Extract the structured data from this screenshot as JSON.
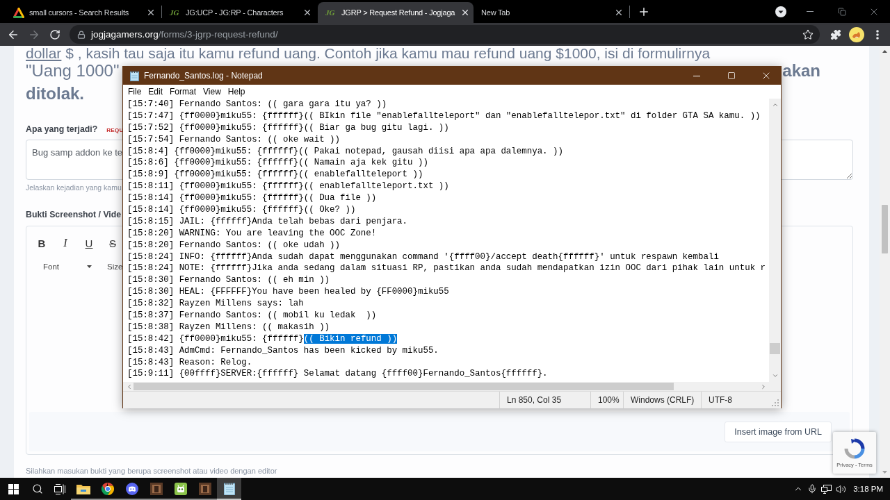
{
  "browser": {
    "tabs": [
      {
        "title": "small cursors - Search Results",
        "selected": false,
        "kind": "triangle"
      },
      {
        "title": "JG:UCP - JG:RP - Characters",
        "selected": false,
        "kind": "lettermark",
        "favicon_text": "JG"
      },
      {
        "title": "JGRP > Request Refund - Jogjaga",
        "selected": true,
        "kind": "lettermark",
        "favicon_text": "JG"
      },
      {
        "title": "New Tab",
        "selected": false,
        "kind": "plain"
      }
    ],
    "forward_disabled": true,
    "address": {
      "host": "jogjagamers.org",
      "path": "/forms/3-jgrp-request-refund/"
    }
  },
  "page": {
    "notice": {
      "link": "dollar",
      "line_1": " $ , kasih tau saja itu kamu refund uang. Contoh jika kamu mau refund uang $1000, isi di formulirnya",
      "line_2_start": "\"Uang 1000\"",
      "line_2_end": "akan",
      "line_3": "ditolak."
    },
    "question": {
      "label": "Apa yang terjadi?",
      "badge": "REQU",
      "value": "Bug samp addon ke te",
      "hint": "Jelaskan kejadian yang kamu"
    },
    "evidence": {
      "label": "Bukti Screenshot / Vide",
      "format_buttons": [
        {
          "kind": "bold",
          "label": "B"
        },
        {
          "kind": "italic",
          "label": "I"
        },
        {
          "kind": "underline",
          "label": "U"
        },
        {
          "kind": "strike",
          "label": "S"
        }
      ],
      "font_select": "Font",
      "size_select": "Size",
      "insert_button": "Insert image from URL",
      "hint": "Silahkan masukan bukti yang berupa screenshot atau video dengan editor"
    },
    "captcha": {
      "links": "Privacy - Terms"
    }
  },
  "notepad": {
    "title": "Fernando_Santos.log - Notepad",
    "menu": [
      "File",
      "Edit",
      "Format",
      "View",
      "Help"
    ],
    "lines": [
      {
        "text": "[15:7:40] Fernando Santos: (( gara gara itu ya? ))",
        "selected": false
      },
      {
        "text": "[15:7:47] {ff0000}miku55: {ffffff}(( BIkin file \"enablefallteleport\" dan \"enablefalltelepor.txt\" di folder GTA SA kamu. ))",
        "selected": false
      },
      {
        "text": "[15:7:52] {ff0000}miku55: {ffffff}(( Biar ga bug gitu lagi. ))",
        "selected": false
      },
      {
        "text": "[15:7:54] Fernando Santos: (( oke wait ))",
        "selected": false
      },
      {
        "text": "[15:8:4] {ff0000}miku55: {ffffff}(( Pakai notepad, gausah diisi apa apa dalemnya. ))",
        "selected": false
      },
      {
        "text": "[15:8:6] {ff0000}miku55: {ffffff}(( Namain aja kek gitu ))",
        "selected": false
      },
      {
        "text": "[15:8:9] {ff0000}miku55: {ffffff}(( enablefallteleport ))",
        "selected": false
      },
      {
        "text": "[15:8:11] {ff0000}miku55: {ffffff}(( enablefallteleport.txt ))",
        "selected": false
      },
      {
        "text": "[15:8:14] {ff0000}miku55: {ffffff}(( Dua file ))",
        "selected": false
      },
      {
        "text": "[15:8:14] {ff0000}miku55: {ffffff}(( Oke? ))",
        "selected": false
      },
      {
        "text": "[15:8:15] JAIL: {ffffff}Anda telah bebas dari penjara.",
        "selected": false
      },
      {
        "text": "[15:8:20] WARNING: You are leaving the OOC Zone!",
        "selected": false
      },
      {
        "text": "[15:8:20] Fernando Santos: (( oke udah ))",
        "selected": false
      },
      {
        "text": "[15:8:24] INFO: {ffffff}Anda sudah dapat menggunakan command '{ffff00}/accept death{ffffff}' untuk respawn kembali",
        "selected": false
      },
      {
        "text": "[15:8:24] NOTE: {ffffff}Jika anda sedang dalam situasi RP, pastikan anda sudah mendapatkan izin OOC dari pihak lain untuk r",
        "selected": false
      },
      {
        "text": "[15:8:30] Fernando Santos: (( eh min ))",
        "selected": false
      },
      {
        "text": "[15:8:30] HEAL: {FFFFFF}You have been healed by {FF0000}miku55",
        "selected": false
      },
      {
        "text": "[15:8:32] Rayzen Millens says: lah",
        "selected": false
      },
      {
        "text": "[15:8:37] Fernando Santos: (( mobil ku ledak  ))",
        "selected": false
      },
      {
        "text": "[15:8:38] Rayzen Millens: (( makasih ))",
        "selected": false
      },
      {
        "text": "[15:8:42] {ff0000}miku55: {ffffff}",
        "selected_text": "(( Bikin refund ))",
        "selected": true
      },
      {
        "text": "[15:8:43] AdmCmd: Fernando_Santos has been kicked by miku55.",
        "selected": false
      },
      {
        "text": "[15:8:43] Reason: Relog.",
        "selected": false
      },
      {
        "text": "[15:9:11] {00ffff}SERVER:{ffffff} Selamat datang {ffff00}Fernando_Santos{ffffff}.",
        "selected": false
      }
    ],
    "status_bar": [
      "Ln 850, Col 35",
      "100%",
      "Windows (CRLF)",
      "UTF-8"
    ]
  },
  "taskbar": {
    "apps": [
      {
        "kind": "folder",
        "running": true,
        "active": false
      },
      {
        "kind": "browser",
        "running": true,
        "active": false
      },
      {
        "kind": "chat",
        "running": true,
        "active": false
      },
      {
        "kind": "picture",
        "running": true,
        "active": false
      },
      {
        "kind": "robot",
        "running": true,
        "active": false
      },
      {
        "kind": "picture",
        "running": true,
        "active": false
      },
      {
        "kind": "notepad",
        "running": true,
        "active": true
      }
    ],
    "clock": "3:18 PM"
  }
}
